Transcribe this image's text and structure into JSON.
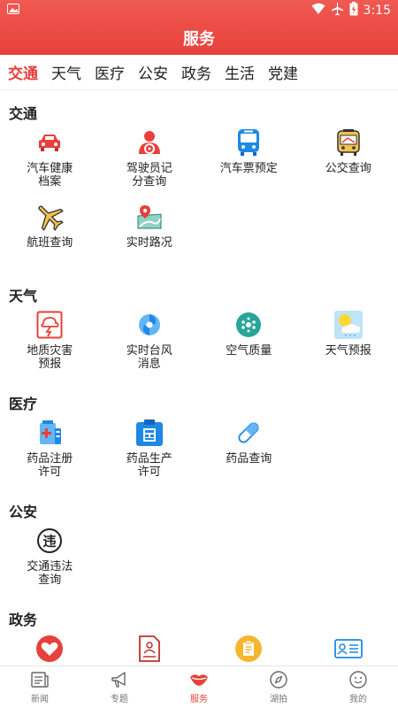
{
  "status": {
    "time": "3:15"
  },
  "header": {
    "title": "服务"
  },
  "tabs": [
    {
      "label": "交通",
      "active": true
    },
    {
      "label": "天气"
    },
    {
      "label": "医疗"
    },
    {
      "label": "公安"
    },
    {
      "label": "政务"
    },
    {
      "label": "生活"
    },
    {
      "label": "党建"
    }
  ],
  "sections": {
    "traffic": {
      "title": "交通",
      "items": [
        {
          "label": "汽车健康\n档案",
          "icon": "car-icon"
        },
        {
          "label": "驾驶员记\n分查询",
          "icon": "driver-icon"
        },
        {
          "label": "汽车票预定",
          "icon": "bus-icon"
        },
        {
          "label": "公交查询",
          "icon": "transit-icon"
        },
        {
          "label": "航班查询",
          "icon": "plane-icon"
        },
        {
          "label": "实时路况",
          "icon": "map-pin-icon"
        }
      ]
    },
    "weather": {
      "title": "天气",
      "items": [
        {
          "label": "地质灾害\n预报",
          "icon": "disaster-icon"
        },
        {
          "label": "实时台风\n消息",
          "icon": "typhoon-icon"
        },
        {
          "label": "空气质量",
          "icon": "air-quality-icon"
        },
        {
          "label": "天气预报",
          "icon": "weather-icon"
        }
      ]
    },
    "medical": {
      "title": "医疗",
      "items": [
        {
          "label": "药品注册\n许可",
          "icon": "medicine-register-icon"
        },
        {
          "label": "药品生产\n许可",
          "icon": "medicine-production-icon"
        },
        {
          "label": "药品查询",
          "icon": "pill-icon"
        }
      ]
    },
    "police": {
      "title": "公安",
      "items": [
        {
          "label": "交通违法\n查询",
          "icon": "violation-icon",
          "glyph": "违"
        }
      ]
    },
    "government": {
      "title": "政务",
      "items": [
        {
          "icon": "heart-icon"
        },
        {
          "icon": "document-icon"
        },
        {
          "icon": "clipboard-icon"
        },
        {
          "icon": "id-card-icon"
        }
      ]
    }
  },
  "bottom_nav": [
    {
      "label": "新闻",
      "icon": "news-icon"
    },
    {
      "label": "专题",
      "icon": "megaphone-icon"
    },
    {
      "label": "服务",
      "icon": "service-lips-icon",
      "active": true
    },
    {
      "label": "湖拍",
      "icon": "compass-icon"
    },
    {
      "label": "我的",
      "icon": "smile-icon"
    }
  ],
  "colors": {
    "brand": "#e8403a",
    "bus_blue": "#1e88e5",
    "gold": "#e6a51e",
    "teal": "#26a69a"
  }
}
